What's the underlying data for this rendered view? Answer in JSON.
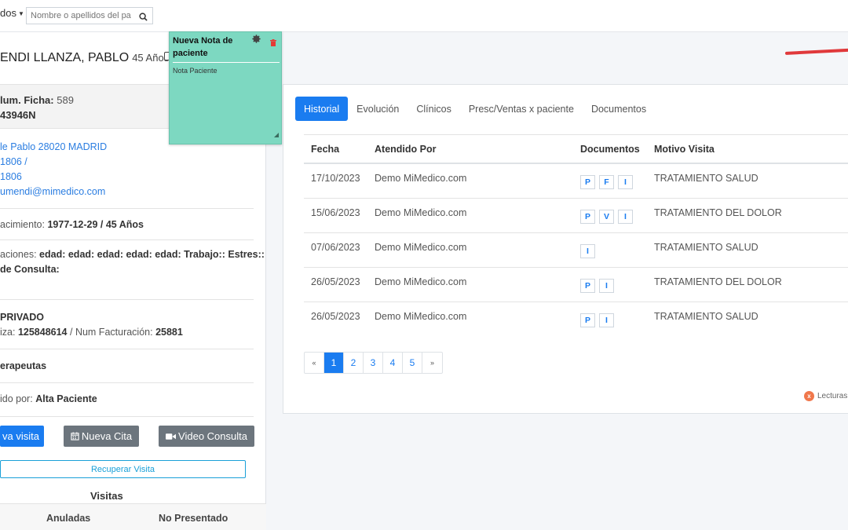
{
  "topbar": {
    "filter_label": "dos",
    "search_placeholder": "Nombre o apellidos del pa"
  },
  "patient": {
    "name": "ENDI LLANZA, PABLO",
    "age": "45 Años",
    "ficha_label": "lum. Ficha:",
    "ficha_value": "589",
    "dni": "43946N",
    "address": "le Pablo 28020 MADRID",
    "phone1": "1806 /",
    "phone2": "1806",
    "email": "umendi@mimedico.com",
    "birth_label": "acimiento:",
    "birth_value": "1977-12-29 / 45 Años",
    "obs_label": "aciones:",
    "obs_value": "edad: edad: edad: edad: edad: Trabajo:: Estres::",
    "consulta_label": "de Consulta:",
    "insurance": "PRIVADO",
    "poliza_label": "iza:",
    "poliza_value": "125848614",
    "facturacion_label": "Num Facturación:",
    "facturacion_value": "25881",
    "terapeutas": "erapeutas",
    "origen_label": "ido por:",
    "origen_value": "Alta Paciente"
  },
  "actions": {
    "nueva_visita": "va visita",
    "nueva_cita": "Nueva Cita",
    "video_consulta": "Video Consulta",
    "recuperar_visita": "Recuperar Visita"
  },
  "visitas": {
    "title": "Visitas",
    "anuladas": "Anuladas",
    "no_presentado": "No Presentado"
  },
  "note": {
    "title": "Nueva Nota de paciente",
    "body": "Nota Paciente"
  },
  "tabs": [
    {
      "label": "Historial",
      "active": true
    },
    {
      "label": "Evolución"
    },
    {
      "label": "Clínicos"
    },
    {
      "label": "Presc/Ventas x paciente"
    },
    {
      "label": "Documentos"
    }
  ],
  "table": {
    "headers": [
      "Fecha",
      "Atendido Por",
      "Documentos",
      "Motivo Visita"
    ],
    "rows": [
      {
        "fecha": "17/10/2023",
        "atendido": "Demo MiMedico.com",
        "docs": [
          "P",
          "F",
          "I"
        ],
        "motivo": "TRATAMIENTO SALUD"
      },
      {
        "fecha": "15/06/2023",
        "atendido": "Demo MiMedico.com",
        "docs": [
          "P",
          "V",
          "I"
        ],
        "motivo": "TRATAMIENTO DEL DOLOR"
      },
      {
        "fecha": "07/06/2023",
        "atendido": "Demo MiMedico.com",
        "docs": [
          "I"
        ],
        "motivo": "TRATAMIENTO SALUD"
      },
      {
        "fecha": "26/05/2023",
        "atendido": "Demo MiMedico.com",
        "docs": [
          "P",
          "I"
        ],
        "motivo": "TRATAMIENTO DEL DOLOR"
      },
      {
        "fecha": "26/05/2023",
        "atendido": "Demo MiMedico.com",
        "docs": [
          "P",
          "I"
        ],
        "motivo": "TRATAMIENTO SALUD"
      }
    ]
  },
  "pagination": {
    "prev": "«",
    "pages": [
      "1",
      "2",
      "3",
      "4",
      "5"
    ],
    "active": "1",
    "next": "»"
  },
  "lecturas": {
    "badge": "x",
    "label": "Lecturas"
  },
  "colors": {
    "primary": "#1a7cf0",
    "note_bg": "#7dd8c1",
    "secondary": "#6c757d",
    "link": "#2a7de1",
    "arrow": "#e0393b"
  }
}
